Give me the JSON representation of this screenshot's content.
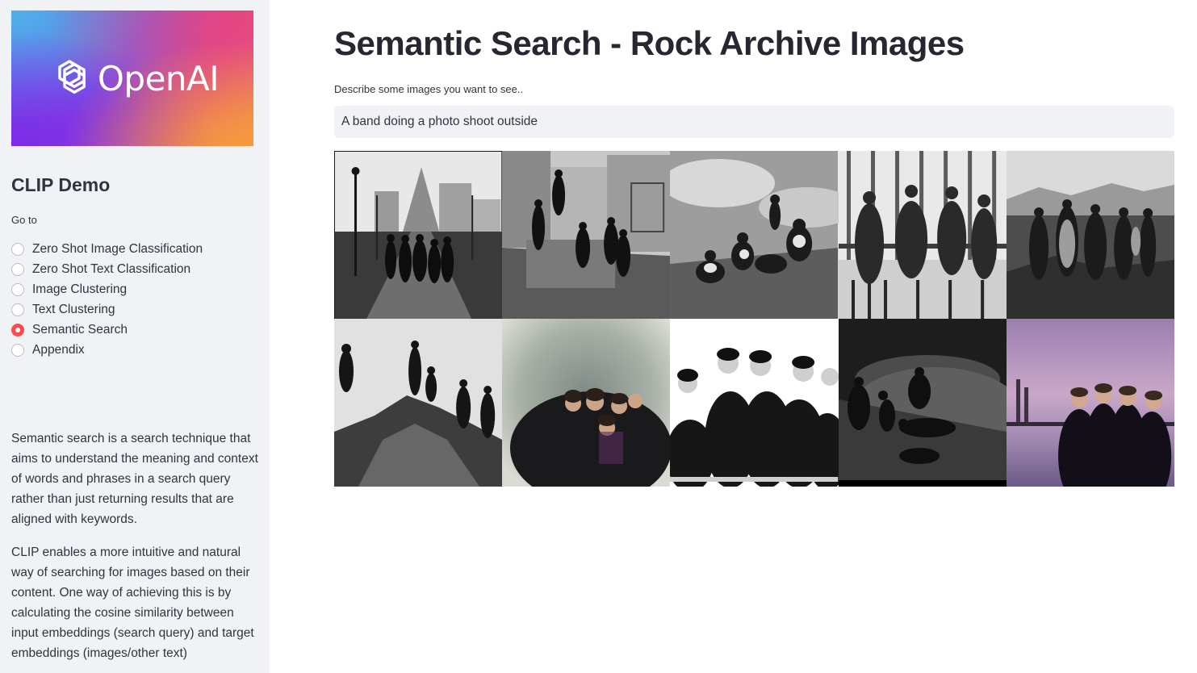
{
  "sidebar": {
    "logo_text": "OpenAI",
    "title": "CLIP Demo",
    "goto_label": "Go to",
    "nav_items": [
      {
        "label": "Zero Shot Image Classification",
        "selected": false
      },
      {
        "label": "Zero Shot Text Classification",
        "selected": false
      },
      {
        "label": "Image Clustering",
        "selected": false
      },
      {
        "label": "Text Clustering",
        "selected": false
      },
      {
        "label": "Semantic Search",
        "selected": true
      },
      {
        "label": "Appendix",
        "selected": false
      }
    ],
    "paragraph1": "Semantic search is a search technique that aims to understand the meaning and context of words and phrases in a search query rather than just returning results that are aligned with keywords.",
    "paragraph2": "CLIP enables a more intuitive and natural way of searching for images based on their content. One way of achieving this is by calculating the cosine similarity between input embeddings (search query) and target embeddings (images/other text)"
  },
  "main": {
    "title": "Semantic Search - Rock Archive Images",
    "input_label": "Describe some images you want to see..",
    "search_value": "A band doing a photo shoot outside",
    "results": [
      {
        "scene": "band-on-pier-city"
      },
      {
        "scene": "band-on-rubble-buildings"
      },
      {
        "scene": "band-sitting-on-ground"
      },
      {
        "scene": "band-by-railings"
      },
      {
        "scene": "band-on-rocky-coast"
      },
      {
        "scene": "band-on-rocks"
      },
      {
        "scene": "band-blurred-portrait"
      },
      {
        "scene": "band-closeup-portrait"
      },
      {
        "scene": "band-lying-on-grass"
      },
      {
        "scene": "band-at-dusk-waterfront"
      }
    ]
  },
  "colors": {
    "sidebar_bg": "#f0f2f6",
    "accent": "#ff4b4b",
    "text": "#31333f"
  }
}
